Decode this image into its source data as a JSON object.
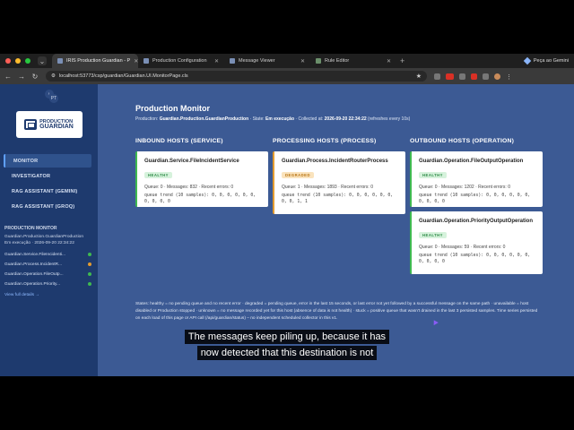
{
  "browser": {
    "tabs": [
      {
        "label": "IRIS Production Guardian - P",
        "active": true
      },
      {
        "label": "Production Configuration",
        "active": false
      },
      {
        "label": "Message Viewer",
        "active": false
      },
      {
        "label": "Rule Editor",
        "active": false
      }
    ],
    "profile_label": "Peça ao Gemini",
    "url": "localhost:53773/csp/guardian/Guardian.UI.MonitorPage.cls"
  },
  "sidebar": {
    "user_initials": "PT",
    "logo_line1": "PRODUCTION",
    "logo_line2": "GUARDIAN",
    "nav": [
      {
        "label": "MONITOR",
        "active": true
      },
      {
        "label": "INVESTIGATOR",
        "active": false
      },
      {
        "label": "RAG ASSISTANT (GEMINI)",
        "active": false
      },
      {
        "label": "RAG ASSISTANT (GROQ)",
        "active": false
      }
    ],
    "section_title": "PRODUCTION MONITOR",
    "production_name": "Guardian.Production.GuardianProduction",
    "production_state": "Em execução · 2026-09-20 22:34:22",
    "hosts": [
      {
        "label": "Guardian.Service.FileIncidenti...",
        "status_color": "#3fb950"
      },
      {
        "label": "Guardian.Process.IncidentR...",
        "status_color": "#e39b2f"
      },
      {
        "label": "Guardian.Operation.FileOutp...",
        "status_color": "#3fb950"
      },
      {
        "label": "Guardian.Operation.Priority...",
        "status_color": "#3fb950"
      }
    ],
    "details_link": "View full details →"
  },
  "main": {
    "title": "Production Monitor",
    "sub_prefix": "Production:",
    "production": "Guardian.Production.GuardianProduction",
    "state_prefix": "· State:",
    "state": "Em execução",
    "collected_prefix": "· Collected at:",
    "collected_at": "2026-09-20 22:34:22",
    "refresh": "(refreshes every 10s)"
  },
  "columns": {
    "inbound_title": "INBOUND HOSTS (SERVICE)",
    "processing_title": "PROCESSING HOSTS (PROCESS)",
    "outbound_title": "OUTBOUND HOSTS (OPERATION)"
  },
  "cards": {
    "service": {
      "name": "Guardian.Service.FileIncidentService",
      "badge": "HEALTHY",
      "stats": "Queue: 0 · Messages: 832 · Recent errors: 0",
      "trend": "queue trend (10 samples): 0, 0, 0, 0, 0, 0, 0, 0, 0, 0"
    },
    "process": {
      "name": "Guardian.Process.IncidentRouterProcess",
      "badge": "DEGRADED",
      "stats": "Queue: 1 · Messages: 1893 · Recent errors: 0",
      "trend": "queue trend (10 samples): 0, 0, 0, 0, 0, 0, 0, 0, 1, 1"
    },
    "file_output": {
      "name": "Guardian.Operation.FileOutputOperation",
      "badge": "HEALTHY",
      "stats": "Queue: 0 · Messages: 1202 · Recent errors: 0",
      "trend": "queue trend (10 samples): 0, 0, 0, 0, 0, 0, 0, 0, 0, 0"
    },
    "priority_output": {
      "name": "Guardian.Operation.PriorityOutputOperation",
      "badge": "HEALTHY",
      "stats": "Queue: 0 · Messages: 59 · Recent errors: 0",
      "trend": "queue trend (10 samples): 0, 0, 0, 0, 0, 0, 0, 0, 0, 0"
    }
  },
  "legend": {
    "text": "States: healthy = no pending queue and no recent error · degraded = pending queue, error in the last 15 seconds, or last error not yet followed by a successful message on the same path · unavailable = host disabled or Production stopped · unknown = no message recorded yet for this host (absence of data is not health) · stuck = positive queue that wasn't drained in the last 3 persisted samples. Time series persisted on each load of this page or API call (/api/guardian/status) – no independent scheduled collector in this v1."
  },
  "caption": {
    "line1": "The messages keep piling up, because it has",
    "line2": "now detected that this destination is not"
  },
  "colors": {
    "page_bg": "#3c5a94",
    "sidebar_bg": "#1e3a6e",
    "healthy": "#2e8b47",
    "degraded": "#b87413",
    "accent": "#5fa0ff"
  }
}
